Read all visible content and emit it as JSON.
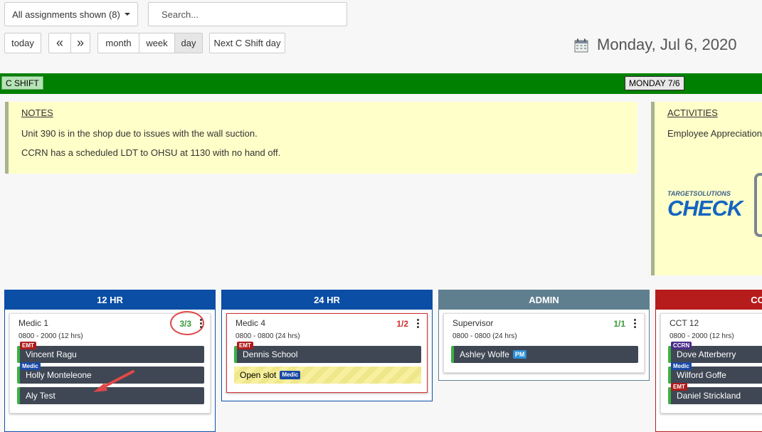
{
  "toolbar": {
    "assignments_label": "All assignments shown (8)",
    "search_placeholder": "Search...",
    "today_label": "today",
    "prev_label": "«",
    "next_label": "»",
    "month_label": "month",
    "week_label": "week",
    "day_label": "day",
    "next_shift_label": "Next C Shift day",
    "active_view": "day"
  },
  "date_title": "Monday, Jul 6, 2020",
  "shift": {
    "name": "C SHIFT",
    "day": "MONDAY 7/6",
    "color": "#008000"
  },
  "notes": {
    "heading": "NOTES",
    "lines": [
      "Unit 390 is in the shop due to issues with the wall suction.",
      "CCRN has a scheduled LDT to OHSU at 1130 with no hand off."
    ]
  },
  "activities": {
    "heading": "ACTIVITIES",
    "line": "Employee Appreciation",
    "logo_top": "TARGETSOLUTIONS",
    "logo_main": "CHECK"
  },
  "columns": [
    {
      "name": "12 HR",
      "color": "#0a4ea5",
      "card": {
        "title": "Medic 1",
        "hours": "0800 - 2000 (12 hrs)",
        "count": "3/3",
        "count_color": "#3a9a3a",
        "people": [
          {
            "name": "Vincent Ragu",
            "badge": "EMT",
            "badge_color": "#b01c1c"
          },
          {
            "name": "Holly Monteleone",
            "badge": "Medic",
            "badge_color": "#1b4aa5"
          },
          {
            "name": "Aly Test",
            "badge": "",
            "badge_color": ""
          }
        ]
      }
    },
    {
      "name": "24 HR",
      "color": "#0a4ea5",
      "card": {
        "title": "Medic 4",
        "hours": "0800 - 0800 (24 hrs)",
        "count": "1/2",
        "count_color": "#d32f2f",
        "people": [
          {
            "name": "Dennis School",
            "badge": "EMT",
            "badge_color": "#b01c1c"
          }
        ],
        "open_slot": {
          "label": "Open slot",
          "badge": "Medic",
          "badge_color": "#1b4aa5"
        }
      }
    },
    {
      "name": "ADMIN",
      "color": "#5f7f8f",
      "card": {
        "title": "Supervisor",
        "hours": "0800 - 0800 (24 hrs)",
        "count": "1/1",
        "count_color": "#3a9a3a",
        "people": [
          {
            "name": "Ashley Wolfe",
            "badge": "PM",
            "badge_color": "#2b8fd6"
          }
        ]
      }
    },
    {
      "name": "CC",
      "color": "#b71c1c",
      "card": {
        "title": "CCT 12",
        "hours": "0800 - 2000 (12 hrs)",
        "count": "",
        "count_color": "#3a9a3a",
        "people": [
          {
            "name": "Dove Atterberry",
            "badge": "CCRN",
            "badge_color": "#4b2c8a"
          },
          {
            "name": "Wilford Goffe",
            "badge": "Medic",
            "badge_color": "#1b4aa5"
          },
          {
            "name": "Daniel Strickland",
            "badge": "EMT",
            "badge_color": "#b01c1c"
          }
        ]
      }
    }
  ]
}
